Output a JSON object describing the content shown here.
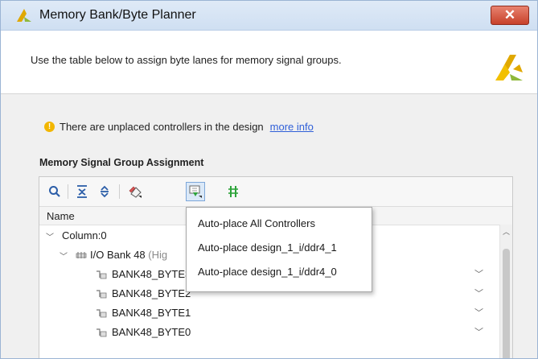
{
  "window": {
    "title": "Memory Bank/Byte Planner",
    "close_label": "✕"
  },
  "header": {
    "description": "Use the table below to assign byte lanes for memory signal groups."
  },
  "warning": {
    "text": "There are unplaced controllers in the design",
    "link": "more info"
  },
  "section": {
    "title": "Memory Signal Group Assignment"
  },
  "toolbar": {
    "buttons": [
      "search-icon",
      "collapse-all-icon",
      "expand-all-icon",
      "place-icon",
      "auto-place-icon",
      "clear-icon"
    ]
  },
  "tree": {
    "column_header": "Name",
    "rows": [
      {
        "label": "Column:0"
      },
      {
        "label": "I/O Bank 48",
        "suffix": "(Hig"
      },
      {
        "label": "BANK48_BYTE3"
      },
      {
        "label": "BANK48_BYTE2"
      },
      {
        "label": "BANK48_BYTE1"
      },
      {
        "label": "BANK48_BYTE0"
      }
    ]
  },
  "menu": {
    "items": [
      "Auto-place All Controllers",
      "Auto-place design_1_i/ddr4_1",
      "Auto-place design_1_i/ddr4_0"
    ]
  },
  "colors": {
    "titlebar": "#cfdff2",
    "close": "#c7402a",
    "link": "#2f5fd8",
    "warning": "#f2b600",
    "logo": "#e0a800"
  }
}
